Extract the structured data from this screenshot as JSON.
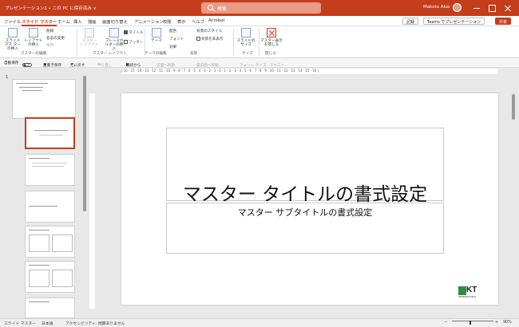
{
  "titlebar": {
    "document": "プレゼンテーション1 • この PC に保存済み ∨",
    "search_placeholder": "検索",
    "user": "Makoto Akai"
  },
  "tabs": [
    "ファイル",
    "スライド マスター",
    "ホーム",
    "挿入",
    "描画",
    "画面切り替え",
    "アニメーション",
    "校閲",
    "表示",
    "ヘルプ",
    "Acrobat"
  ],
  "tabs_right": {
    "comments": "記録",
    "teams": "Teams でプレゼンテーション",
    "share": "共有"
  },
  "ribbon": {
    "insert_master": "スライド マス ターの挿入",
    "insert_layout": "レイアウトの挿入",
    "delete": "削除",
    "rename": "名前の変更",
    "preserve": "保持",
    "master_layout": "マスター レイアウト",
    "insert_placeholder": "プレースホルダーの挿入",
    "title_check": "タイトル",
    "footer_check": "フッター",
    "themes": "テーマ",
    "colors": "配色",
    "fonts": "フォント",
    "effects": "効果",
    "bg_styles": "背景のスタイル",
    "hide_bg": "背景を非表示",
    "slide_size": "スライドのサイズ",
    "close_master": "マスター表示を閉じる",
    "group_edit_master": "マスターの編集",
    "group_layout": "マスター レイアウト",
    "group_theme": "テーマの編集",
    "group_bg": "背景",
    "group_size": "サイズ",
    "group_close": "閉じる"
  },
  "qat": {
    "autosave": "自動保存",
    "autosave_state": "オフ",
    "save": "上書き保存",
    "undo": "元に戻す",
    "redo": "やり直し",
    "from_start": "最初から",
    "sort_front": "前面へ移動",
    "sort_back": "最前面へ移動",
    "font_size": "フォント サイズ",
    "text": "テキスト"
  },
  "thumbs": {
    "slide_number": "1",
    "master_title": "マスター タイトルの書式設定",
    "master_sub": "マスター サブタイトルの書式設定"
  },
  "ruler": "| 16 · 15 · 14 · 13 · 12 · 11 · 10 · 9 · 8 · 7 · 6 · 5 · 4 · 3 · 2 · 1 · 0 · 1 · 2 · 3 · 4 · 5 · 6 · 7 · 8 · 9 · 10 · 11 · 12 · 13 · 14 · 15 · 16 |",
  "slide": {
    "title": "マスター タイトルの書式設定",
    "subtitle": "マスター サブタイトルの書式設定",
    "logo_text": "KT",
    "logo_sub": "INTERNATIONAL"
  },
  "status": {
    "view": "スライド マスター",
    "language": "日本語",
    "accessibility": "アクセシビリティ: 問題ありません",
    "zoom": "90%"
  }
}
